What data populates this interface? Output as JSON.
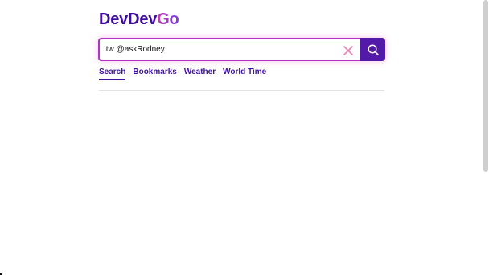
{
  "logo": {
    "part1": "DevDev",
    "part2": "Go"
  },
  "search": {
    "value": "!tw @askRodney",
    "clear_icon": "close-x-icon",
    "submit_icon": "magnifier-icon"
  },
  "tabs": [
    {
      "label": "Search",
      "active": true
    },
    {
      "label": "Bookmarks",
      "active": false
    },
    {
      "label": "Weather",
      "active": false
    },
    {
      "label": "World Time",
      "active": false
    }
  ],
  "colors": {
    "brand": "#3f0f9a",
    "accent": "#b333c9",
    "button": "#5319a8",
    "clear": "#e87fb0"
  }
}
